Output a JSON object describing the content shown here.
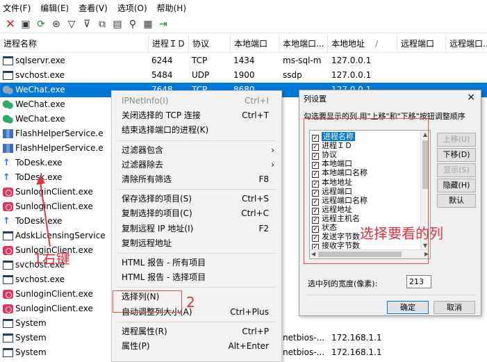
{
  "menu": [
    "文件(F)",
    "编辑(E)",
    "查看(V)",
    "选项(O)",
    "帮助(H)"
  ],
  "toolbar_icons": [
    "close-x-icon",
    "save-icon",
    "refresh-icon",
    "network-icon",
    "filter-icon",
    "filter-remove-icon",
    "copy-icon",
    "properties-icon",
    "find-icon",
    "html-report-icon",
    "exit-icon"
  ],
  "columns": [
    "进程名称",
    "进程ＩＤ",
    "协议",
    "本地端口",
    "本地端口...",
    "本地地址",
    "远程端口",
    "远程端口..."
  ],
  "sort_indicator": "∕",
  "rows": [
    {
      "icon": "win",
      "name": "sqlservr.exe",
      "pid": "6244",
      "proto": "TCP",
      "lport": "1434",
      "lname": "ms-sql-m",
      "laddr": "127.0.0.1"
    },
    {
      "icon": "win",
      "name": "svchost.exe",
      "pid": "5484",
      "proto": "UDP",
      "lport": "1900",
      "lname": "ssdp",
      "laddr": "127.0.0.1"
    },
    {
      "icon": "wechat-gray",
      "name": "WeChat.exe",
      "pid": "7648",
      "proto": "TCP",
      "lport": "8680",
      "lname": "",
      "laddr": "127.0.0.1",
      "selected": true
    },
    {
      "icon": "wechat",
      "name": "WeChat.exe",
      "pid": "",
      "proto": "",
      "lport": "",
      "lname": "",
      "laddr": ""
    },
    {
      "icon": "wechat",
      "name": "WeChat.exe",
      "pid": "",
      "proto": "",
      "lport": "",
      "lname": "",
      "laddr": ""
    },
    {
      "icon": "flash",
      "name": "FlashHelperService.e",
      "pid": "",
      "proto": "",
      "lport": "",
      "lname": "",
      "laddr": ""
    },
    {
      "icon": "flash",
      "name": "FlashHelperService.e",
      "pid": "",
      "proto": "",
      "lport": "",
      "lname": "",
      "laddr": ""
    },
    {
      "icon": "todesk",
      "name": "ToDesk.exe",
      "pid": "",
      "proto": "",
      "lport": "",
      "lname": "",
      "laddr": ""
    },
    {
      "icon": "todesk",
      "name": "ToDesk.exe",
      "pid": "",
      "proto": "",
      "lport": "",
      "lname": "",
      "laddr": ""
    },
    {
      "icon": "sun",
      "name": "SunloginClient.exe",
      "pid": "",
      "proto": "",
      "lport": "",
      "lname": "",
      "laddr": ""
    },
    {
      "icon": "sun",
      "name": "SunloginClient.exe",
      "pid": "",
      "proto": "",
      "lport": "",
      "lname": "",
      "laddr": ""
    },
    {
      "icon": "todesk",
      "name": "ToDesk.exe",
      "pid": "",
      "proto": "",
      "lport": "",
      "lname": "",
      "laddr": ""
    },
    {
      "icon": "win",
      "name": "AdskLicensingService",
      "pid": "",
      "proto": "",
      "lport": "",
      "lname": "",
      "laddr": ""
    },
    {
      "icon": "sun",
      "name": "SunloginClient.exe",
      "pid": "",
      "proto": "",
      "lport": "",
      "lname": "",
      "laddr": ""
    },
    {
      "icon": "win",
      "name": "svchost.exe",
      "pid": "",
      "proto": "",
      "lport": "",
      "lname": "",
      "laddr": ""
    },
    {
      "icon": "win",
      "name": "svchost.exe",
      "pid": "",
      "proto": "",
      "lport": "",
      "lname": "",
      "laddr": ""
    },
    {
      "icon": "sun",
      "name": "SunloginClient.exe",
      "pid": "",
      "proto": "",
      "lport": "",
      "lname": "",
      "laddr": ""
    },
    {
      "icon": "sun",
      "name": "SunloginClient.exe",
      "pid": "",
      "proto": "",
      "lport": "",
      "lname": "",
      "laddr": ""
    },
    {
      "icon": "win",
      "name": "System",
      "pid": "",
      "proto": "",
      "lport": "",
      "lname": "",
      "laddr": ""
    },
    {
      "icon": "win",
      "name": "System",
      "pid": "",
      "proto": "",
      "lport": "",
      "lname": "netbios-...",
      "laddr": "172.168.1.1"
    },
    {
      "icon": "win",
      "name": "System",
      "pid": "",
      "proto": "",
      "lport": "",
      "lname": "netbios-...",
      "laddr": "172.168.1.1"
    },
    {
      "icon": "win",
      "name": "System",
      "pid": "",
      "proto": "",
      "lport": "",
      "lname": "netbios-...",
      "laddr": "172.168.1.1"
    }
  ],
  "context_menu": [
    {
      "label": "IPNetInfo(I)",
      "shortcut": "Ctrl+I",
      "disabled": true
    },
    {
      "label": "关闭选择的 TCP 连接",
      "shortcut": "Ctrl+T"
    },
    {
      "label": "结束选择端口的进程(K)",
      "shortcut": ""
    },
    {
      "sep": true
    },
    {
      "label": "过滤器包含",
      "submenu": "›"
    },
    {
      "label": "过滤器除去",
      "submenu": "›"
    },
    {
      "label": "清除所有筛选",
      "shortcut": "F8"
    },
    {
      "sep": true
    },
    {
      "label": "保存选择的项目(S)",
      "shortcut": "Ctrl+S"
    },
    {
      "label": "复制选择的项目(C)",
      "shortcut": "Ctrl+C"
    },
    {
      "label": "复制远程 IP 地址(I)",
      "shortcut": "F2"
    },
    {
      "label": "复制远程地址",
      "shortcut": ""
    },
    {
      "sep": true
    },
    {
      "label": "HTML 报告 - 所有项目",
      "shortcut": ""
    },
    {
      "label": "HTML 报告 - 选择项目",
      "shortcut": ""
    },
    {
      "sep": true
    },
    {
      "label": "选择列(N)",
      "shortcut": ""
    },
    {
      "label": "自动调整列大小(A)",
      "shortcut": "Ctrl+Plus"
    },
    {
      "sep": true
    },
    {
      "label": "进程属性(R)",
      "shortcut": "Ctrl+P"
    },
    {
      "label": "属性(P)",
      "shortcut": "Alt+Enter"
    }
  ],
  "dialog": {
    "title": "列设置",
    "close": "×",
    "description": "勾选要显示的列.用\"上移\"和\"下移\"按钮调整顺序",
    "columns": [
      "进程名称",
      "进程ＩＤ",
      "协议",
      "本地端口",
      "本地端口名称",
      "本地地址",
      "远程端口",
      "远程端口名称",
      "远程地址",
      "远程主机名",
      "状态",
      "发送字节数",
      "接收字节数",
      "已发送包数"
    ],
    "check": "☑",
    "buttons": {
      "up": "上移(U)",
      "down": "下移(D)",
      "show": "显示(S)",
      "hide": "隐藏(H)",
      "default": "默认"
    },
    "width_label": "选中列的宽度(像素):",
    "width_value": "213",
    "ok": "确定",
    "cancel": "取消"
  },
  "annotations": {
    "step1": "1右键",
    "step2": "2",
    "hint": "选择要看的列"
  }
}
